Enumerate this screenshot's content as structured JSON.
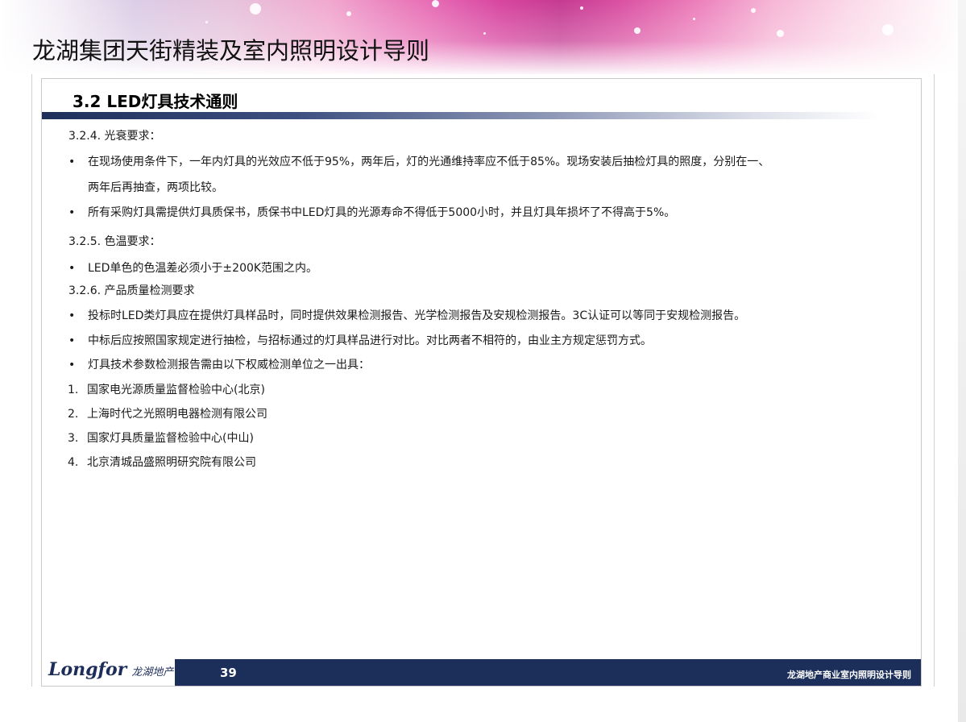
{
  "header": {
    "title": "龙湖集团天街精装及室内照明设计导则"
  },
  "section": {
    "title": "3.2 LED灯具技术通则"
  },
  "content": {
    "s1_heading": "3.2.4. 光衰要求：",
    "s1_b1_l1": "在现场使用条件下，一年内灯具的光效应不低于95%，两年后，灯的光通维持率应不低于85%。现场安装后抽检灯具的照度，分别在一、",
    "s1_b1_l2": "两年后再抽查，两项比较。",
    "s1_b2": "所有采购灯具需提供灯具质保书，质保书中LED灯具的光源寿命不得低于5000小时，并且灯具年损坏了不得高于5%。",
    "s2_heading": "3.2.5. 色温要求：",
    "s2_b1": "LED单色的色温差必须小于±200K范围之内。",
    "s3_heading": "3.2.6. 产品质量检测要求",
    "s3_b1": "投标时LED类灯具应在提供灯具样品时，同时提供效果检测报告、光学检测报告及安规检测报告。3C认证可以等同于安规检测报告。",
    "s3_b2": "中标后应按照国家规定进行抽检，与招标通过的灯具样品进行对比。对比两者不相符的，由业主方规定惩罚方式。",
    "s3_b3": "灯具技术参数检测报告需由以下权威检测单位之一出具：",
    "bullet_symbol": "•",
    "list": [
      {
        "num": "1.",
        "text": "国家电光源质量监督检验中心(北京)"
      },
      {
        "num": "2.",
        "text": "上海时代之光照明电器检测有限公司"
      },
      {
        "num": "3.",
        "text": "国家灯具质量监督检验中心(中山)"
      },
      {
        "num": "4.",
        "text": "北京清城品盛照明研究院有限公司"
      }
    ]
  },
  "footer": {
    "logo_brand": "Longfor",
    "logo_cn": "龙湖地产",
    "page_number": "39",
    "doc_title": "龙湖地产商业室内照明设计导则"
  },
  "colors": {
    "navy": "#1c2f5b",
    "banner_magenta": "#d7449f"
  }
}
